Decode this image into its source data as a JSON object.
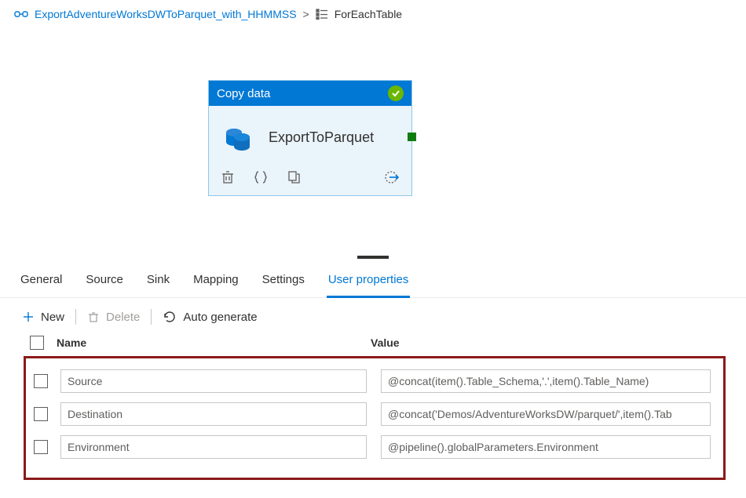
{
  "breadcrumb": {
    "parent": "ExportAdventureWorksDWToParquet_with_HHMMSS",
    "current": "ForEachTable"
  },
  "activity": {
    "type_label": "Copy data",
    "name": "ExportToParquet"
  },
  "tabs": {
    "general": "General",
    "source": "Source",
    "sink": "Sink",
    "mapping": "Mapping",
    "settings": "Settings",
    "user_props": "User properties"
  },
  "toolbar": {
    "new_label": "New",
    "delete_label": "Delete",
    "auto_label": "Auto generate"
  },
  "table": {
    "header_name": "Name",
    "header_value": "Value",
    "rows": [
      {
        "name": "Source",
        "value": "@concat(item().Table_Schema,'.',item().Table_Name)"
      },
      {
        "name": "Destination",
        "value": "@concat('Demos/AdventureWorksDW/parquet/',item().Tab"
      },
      {
        "name": "Environment",
        "value": "@pipeline().globalParameters.Environment"
      }
    ]
  }
}
